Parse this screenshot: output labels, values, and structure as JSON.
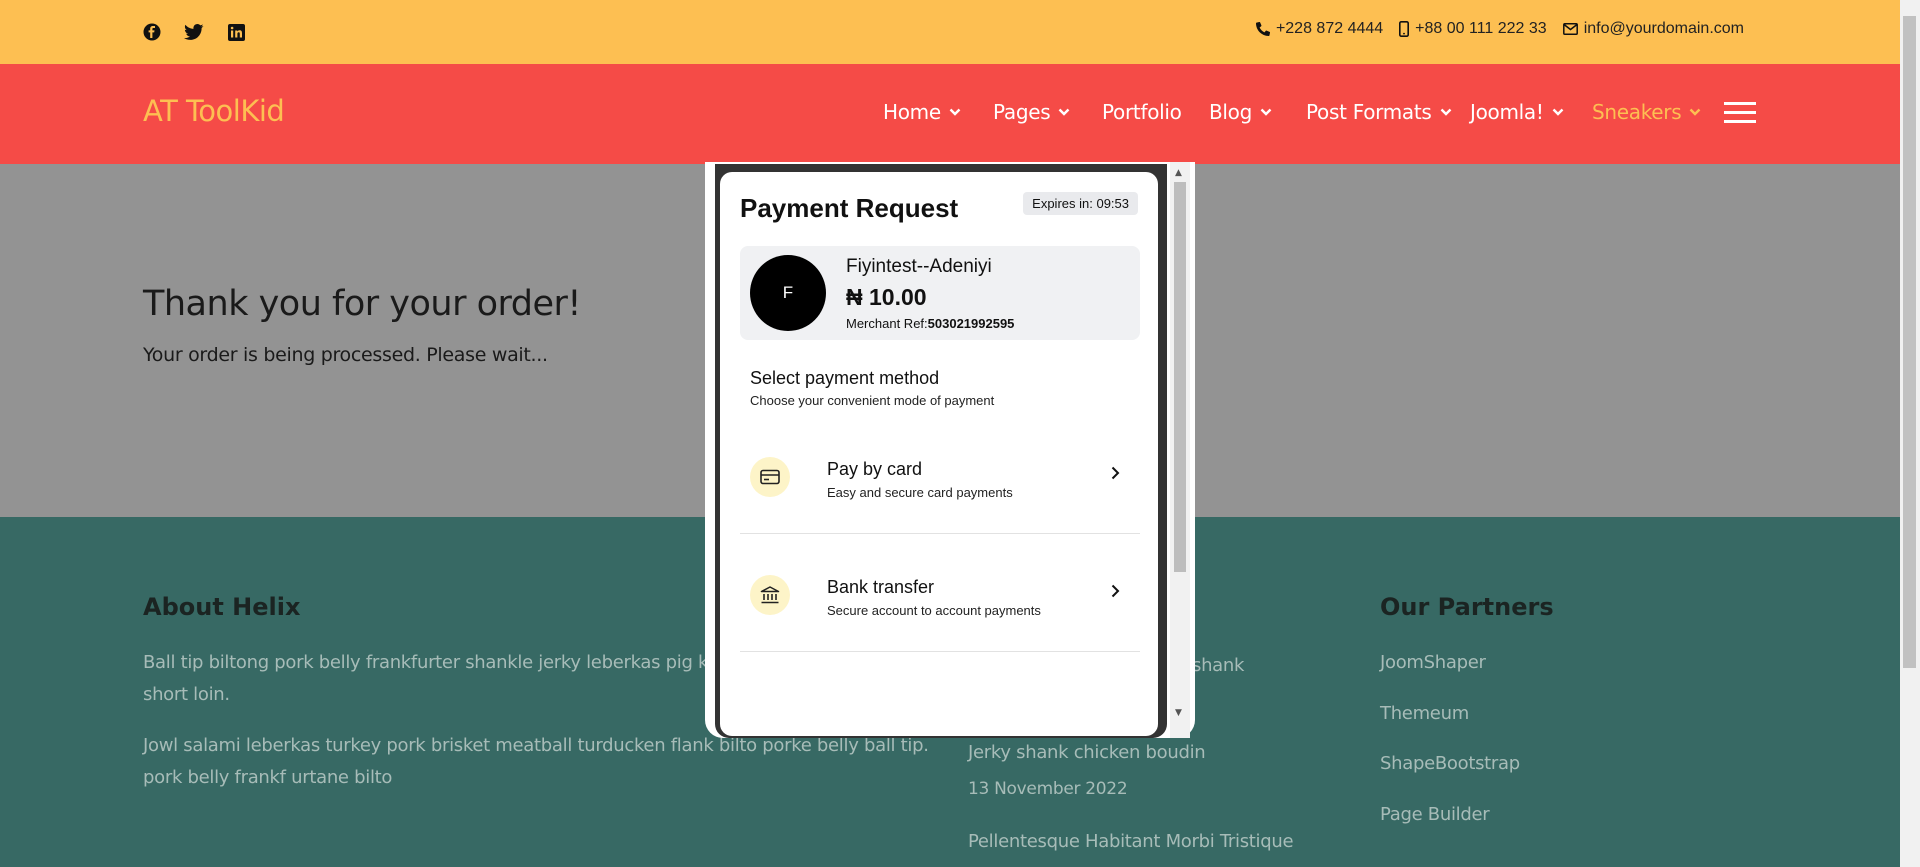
{
  "topbar": {
    "social": [
      "facebook-icon",
      "twitter-icon",
      "linkedin-icon"
    ],
    "phone": "+228 872 4444",
    "mobile": "+88 00 111 222 33",
    "email": "info@yourdomain.com"
  },
  "nav": {
    "logo": "AT ToolKid",
    "items": [
      {
        "label": "Home",
        "dropdown": true
      },
      {
        "label": "Pages",
        "dropdown": true
      },
      {
        "label": "Portfolio",
        "dropdown": false
      },
      {
        "label": "Blog",
        "dropdown": true
      },
      {
        "label": "Post Formats",
        "dropdown": true
      },
      {
        "label": "Joomla!",
        "dropdown": true
      },
      {
        "label": "Sneakers",
        "dropdown": true,
        "active": true
      }
    ]
  },
  "hero": {
    "title": "Thank you for your order!",
    "subtitle": "Your order is being processed. Please wait..."
  },
  "footer": {
    "about_title": "About Helix",
    "about_p1_line1": "Ball tip biltong pork belly frankfurter shankle jerky leberkas pig kie",
    "about_p1_line2": "short loin.",
    "about_p2_line1": "Jowl salami leberkas turkey pork brisket meatball turducken flank bilto porke belly ball tip.",
    "about_p2_line2": "pork belly frankf urtane bilto",
    "posts_fragment": "shank",
    "post2_title": "Jerky shank chicken boudin",
    "post2_date": "13 November 2022",
    "post3_title": "Pellentesque Habitant Morbi Tristique",
    "partners_title": "Our Partners",
    "partners": [
      "JoomShaper",
      "Themeum",
      "ShapeBootstrap",
      "Page Builder"
    ]
  },
  "payment": {
    "title": "Payment Request",
    "expires": "Expires in: 09:53",
    "avatar_letter": "F",
    "merchant_name": "Fiyintest--Adeniyi",
    "amount": "₦ 10.00",
    "merchant_ref_label": "Merchant Ref:",
    "merchant_ref": "503021992595",
    "select_title": "Select payment method",
    "select_sub": "Choose your convenient mode of payment",
    "options": [
      {
        "title": "Pay by card",
        "subtitle": "Easy and secure card payments",
        "icon": "credit-card-icon"
      },
      {
        "title": "Bank transfer",
        "subtitle": "Secure account to account payments",
        "icon": "bank-icon"
      }
    ]
  },
  "colors": {
    "topbar": "#fdbf52",
    "nav": "#f54b47",
    "hero": "#939393",
    "footer": "#376964",
    "accent": "#fdbf52"
  }
}
